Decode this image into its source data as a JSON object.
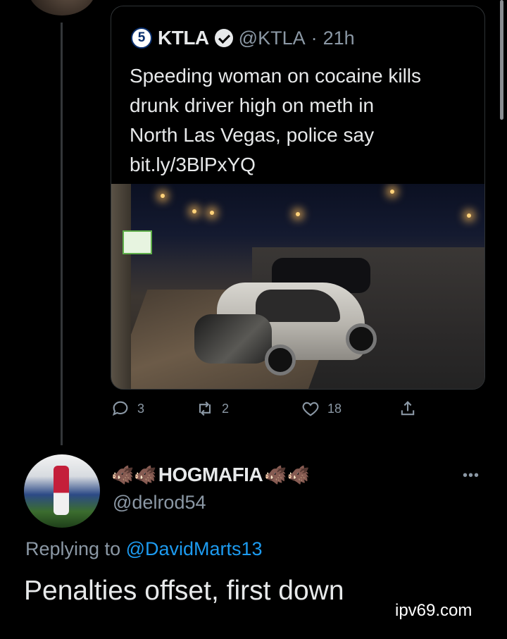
{
  "quoted_tweet": {
    "name": "KTLA",
    "logo_text": "5",
    "handle": "@KTLA",
    "separator": "·",
    "time": "21h",
    "text_lines": [
      "Speeding woman on cocaine kills",
      "drunk driver high on meth in",
      "North Las Vegas, police say",
      "bit.ly/3BlPxYQ"
    ],
    "image_icon": "crash-scene-photo"
  },
  "actions": {
    "reply_count": "3",
    "retweet_count": "2",
    "like_count": "18"
  },
  "reply": {
    "name": "HOGMAFIA",
    "emoji_left": "🐗🐗",
    "emoji_right": "🐗🐗",
    "handle": "@delrod54",
    "more": "•••",
    "replying_prefix": "Replying to ",
    "replying_mention": "@DavidMarts13",
    "text": "Penalties offset, first down"
  },
  "watermark": "ipv69.com",
  "colors": {
    "background": "#000000",
    "text_primary": "#e7e9ea",
    "text_secondary": "#8b98a5",
    "link": "#1d9bf0",
    "border": "#2f3336"
  }
}
